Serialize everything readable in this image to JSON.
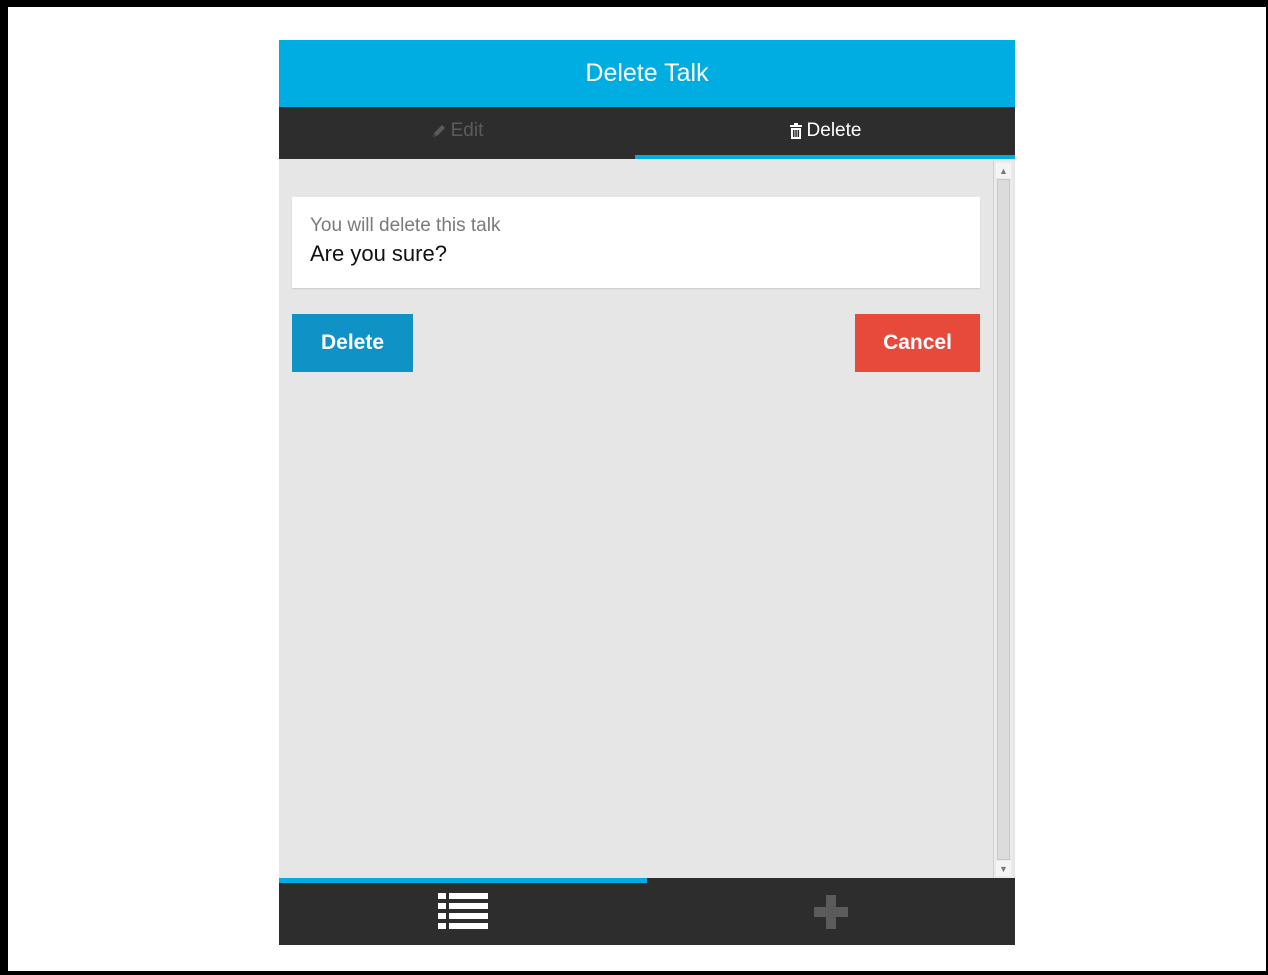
{
  "window": {
    "title": "Delete Talk"
  },
  "tabs": [
    {
      "label": "Edit",
      "icon": "pencil-icon",
      "active": false
    },
    {
      "label": "Delete",
      "icon": "trash-icon",
      "active": true
    }
  ],
  "message": {
    "line1": "You will delete this talk",
    "line2": "Are you sure?"
  },
  "actions": {
    "delete_label": "Delete",
    "cancel_label": "Cancel"
  },
  "bottom_nav": [
    {
      "icon": "list-icon",
      "active": true
    },
    {
      "icon": "plus-icon",
      "active": false
    }
  ],
  "colors": {
    "accent": "#00ade2",
    "dark_bar": "#2d2d2d",
    "delete_button": "#0f93c6",
    "cancel_button": "#e74a3b",
    "content_bg": "#e6e6e6"
  }
}
